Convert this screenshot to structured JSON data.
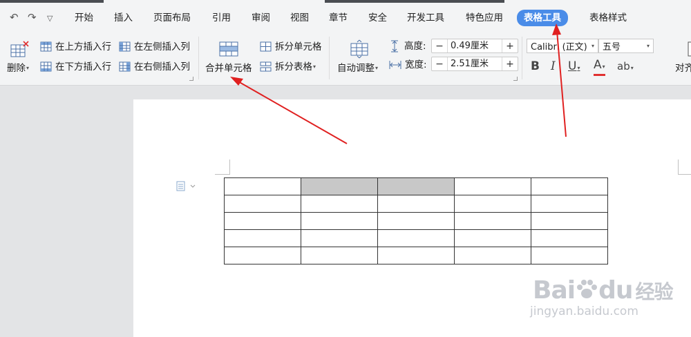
{
  "quick_access": {
    "undo_icon": "undo-icon",
    "redo_icon": "redo-icon",
    "more_icon": "chevron-down-icon"
  },
  "menu": {
    "tabs": [
      "开始",
      "插入",
      "页面布局",
      "引用",
      "审阅",
      "视图",
      "章节",
      "安全",
      "开发工具",
      "特色应用",
      "表格工具",
      "表格样式"
    ],
    "active_tab": "表格工具"
  },
  "ribbon": {
    "delete_label": "删除",
    "insert_row_above": "在上方插入行",
    "insert_row_below": "在下方插入行",
    "insert_col_left": "在左侧插入列",
    "insert_col_right": "在右侧插入列",
    "merge_cells": "合并单元格",
    "split_cells": "拆分单元格",
    "split_table": "拆分表格",
    "auto_fit": "自动调整",
    "height_label": "高度:",
    "height_value": "0.49厘米",
    "width_label": "宽度:",
    "width_value": "2.51厘米",
    "font_name": "Calibri (正文)",
    "font_size": "五号",
    "bold": "B",
    "italic": "I",
    "underline": "U",
    "font_color": "A",
    "char_shading": "ab",
    "align_label": "对齐"
  },
  "document": {
    "table": {
      "rows": 5,
      "cols": 5,
      "selected_cells": [
        [
          0,
          1
        ],
        [
          0,
          2
        ]
      ]
    },
    "watermark": {
      "brand": "Bai",
      "brand_tail": "du",
      "brand_cn": "经验",
      "url": "jingyan.baidu.com"
    }
  },
  "colors": {
    "accent": "#4a8ce8",
    "arrow": "#e02020",
    "selected_cell": "#c8c8c8"
  }
}
